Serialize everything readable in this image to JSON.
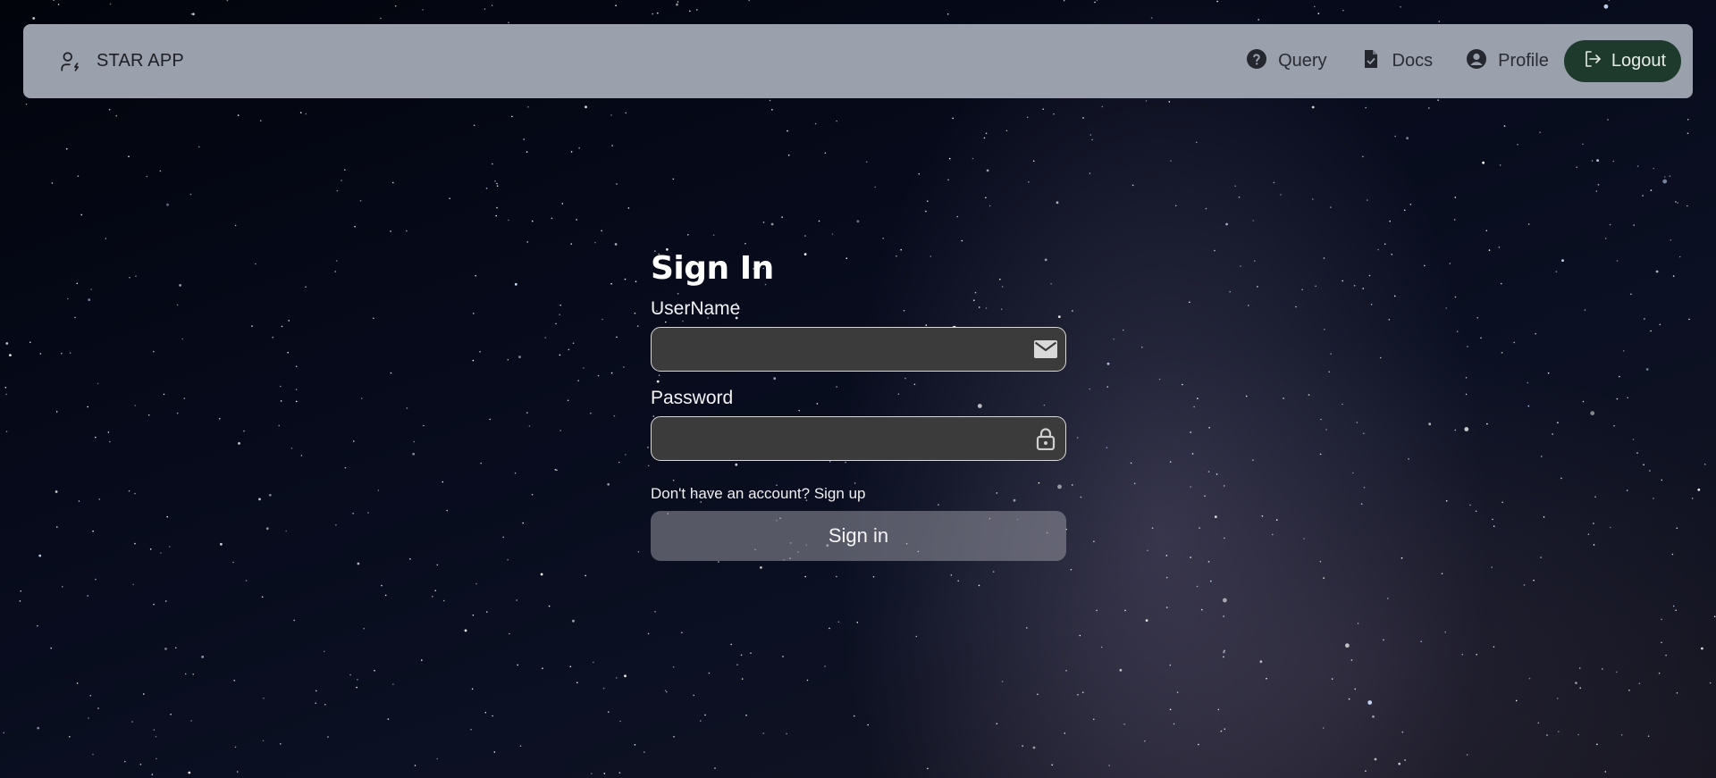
{
  "header": {
    "brand_icon": "user-bolt-icon",
    "brand_title": "STAR APP",
    "nav": [
      {
        "icon": "question-circle-icon",
        "label": "Query"
      },
      {
        "icon": "document-check-icon",
        "label": "Docs"
      },
      {
        "icon": "user-circle-icon",
        "label": "Profile"
      }
    ],
    "logout": {
      "icon": "logout-icon",
      "label": "Logout"
    }
  },
  "signin": {
    "title": "Sign In",
    "username_label": "UserName",
    "username_value": "",
    "username_icon": "envelope-icon",
    "password_label": "Password",
    "password_value": "",
    "password_icon": "lock-icon",
    "signup_text": "Don't have an account? Sign up",
    "submit_label": "Sign in"
  },
  "colors": {
    "navbar_bg": "#9aa0ac",
    "logout_bg": "#1d3a2c",
    "input_bg": "#3b3b3b",
    "background": "#070b1c"
  }
}
